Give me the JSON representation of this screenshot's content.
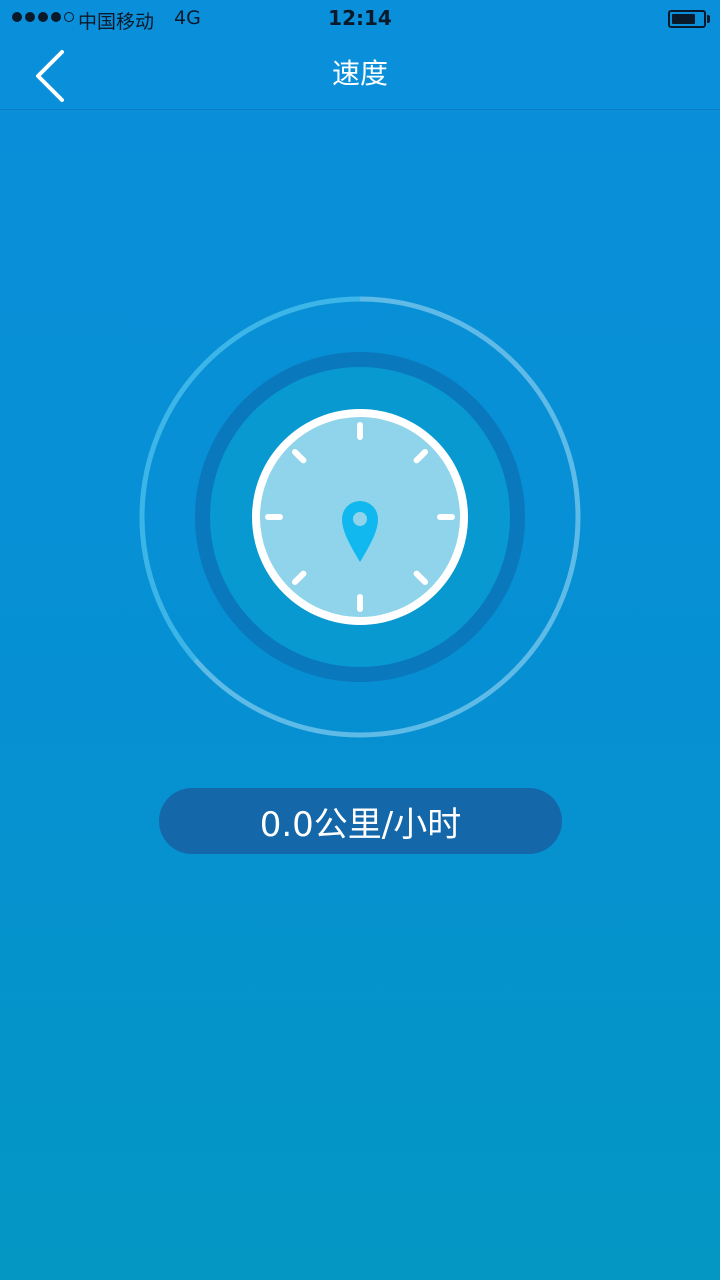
{
  "status_bar": {
    "carrier": "中国移动",
    "network": "4G",
    "time": "12:14",
    "signal_bars_filled": 4,
    "signal_bars_total": 5,
    "battery_level": 0.75
  },
  "nav": {
    "title": "速度",
    "back_icon": "chevron-left-icon"
  },
  "gauge": {
    "center_icon": "location-pin-icon",
    "tick_count": 8,
    "progress": 0.0
  },
  "speed": {
    "display": "0.0公里/小时"
  },
  "colors": {
    "background_top": "#0a8fda",
    "background_bottom": "#0497c3",
    "pill": "#1467a8",
    "dial_face": "#8fd4ea",
    "pin": "#10b8ef",
    "white": "#ffffff"
  }
}
